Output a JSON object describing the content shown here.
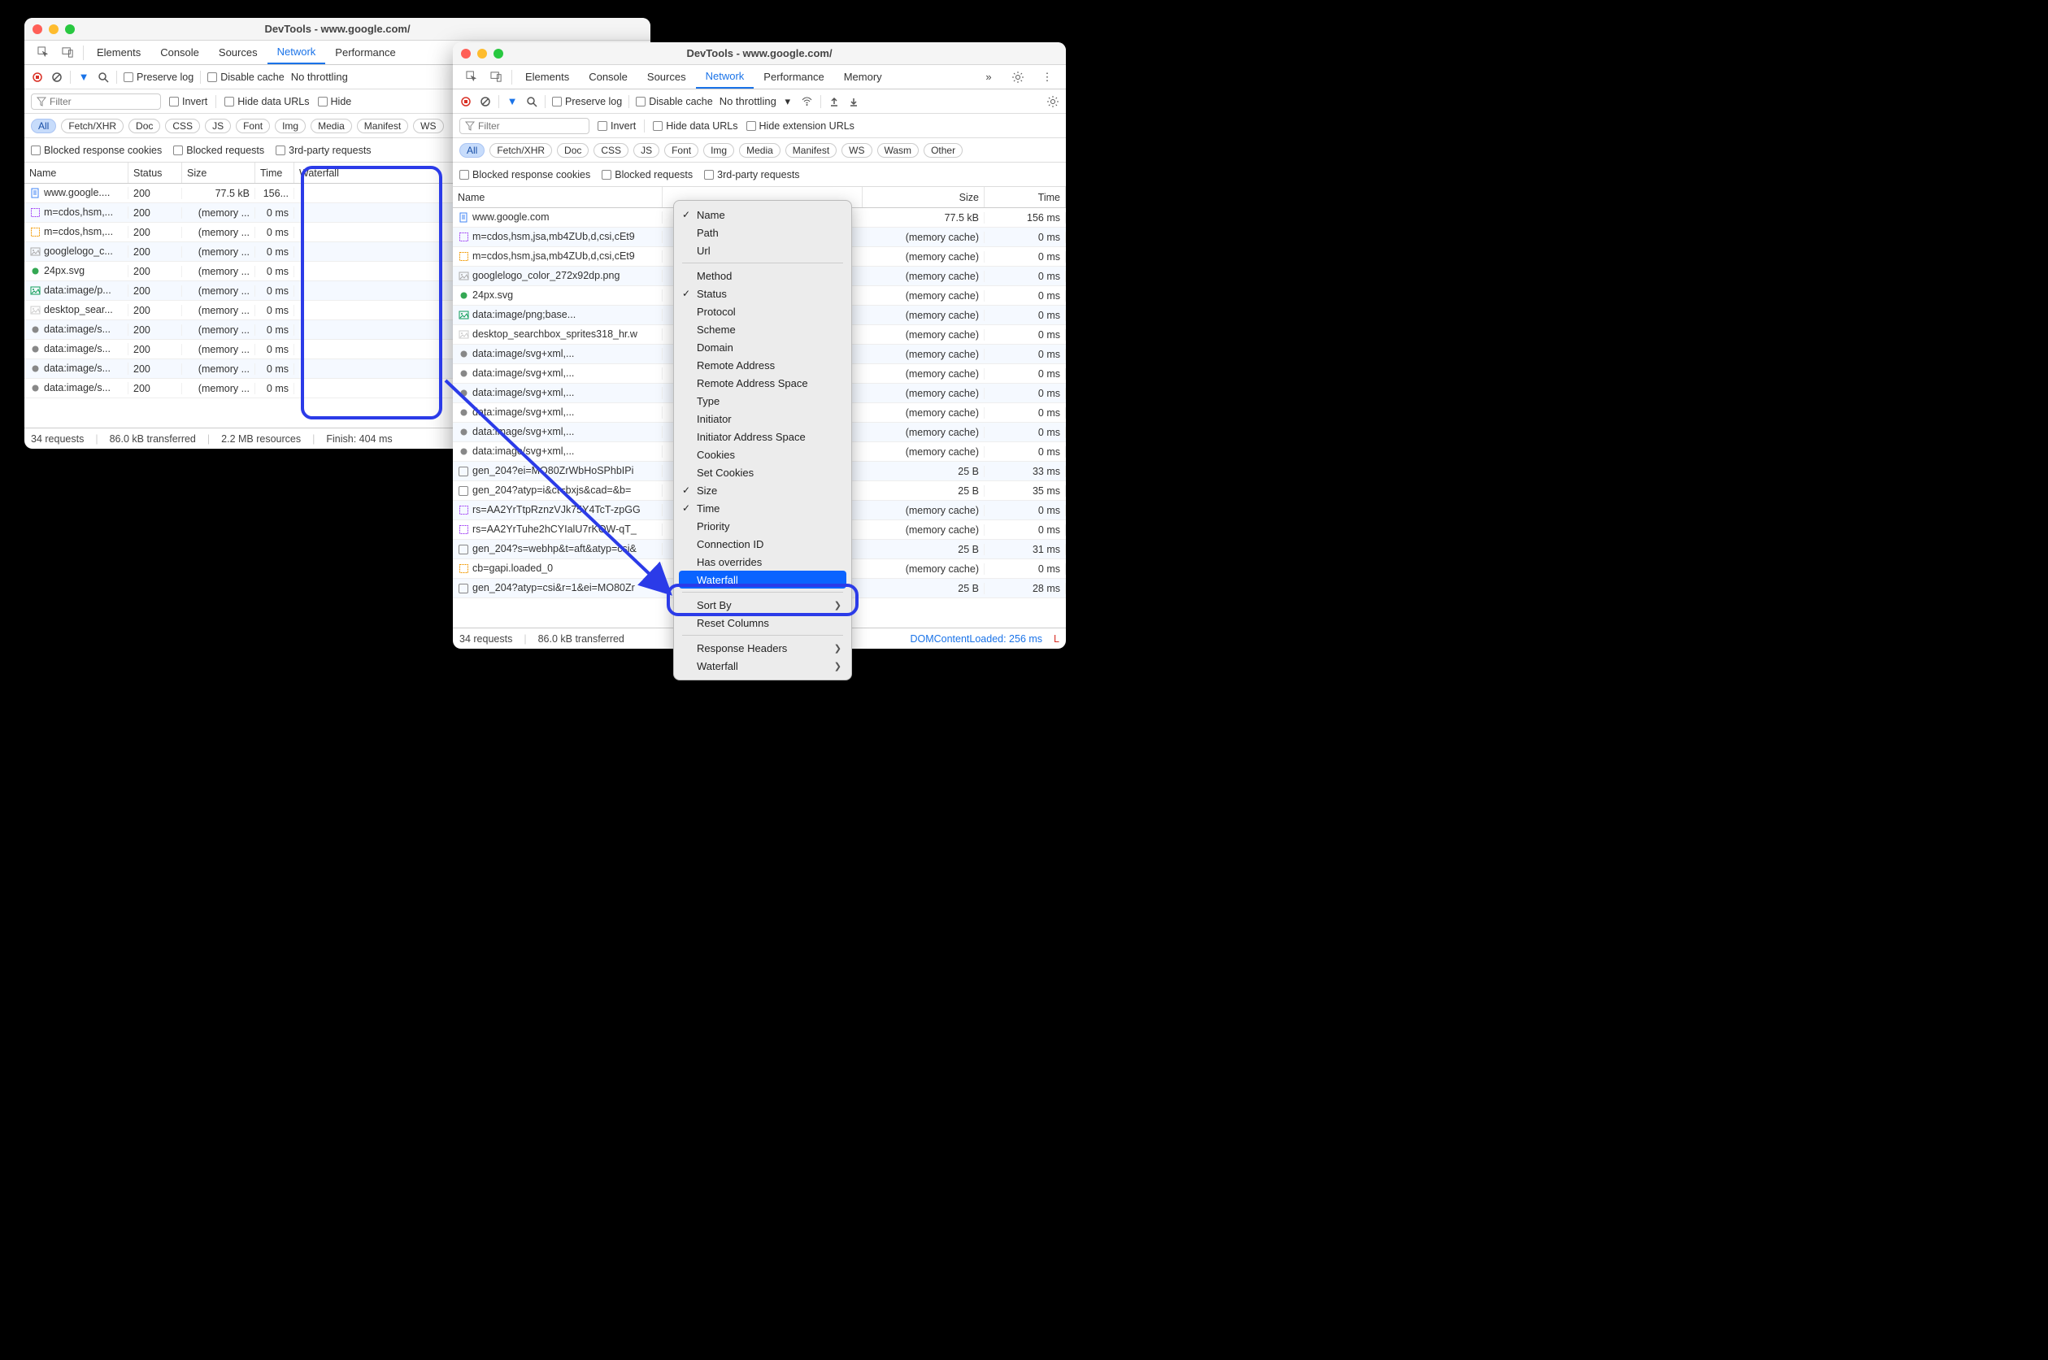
{
  "window1": {
    "title": "DevTools - www.google.com/",
    "tabs": [
      "Elements",
      "Console",
      "Sources",
      "Network",
      "Performance"
    ],
    "activeTab": "Network",
    "toolbar": {
      "preserve": "Preserve log",
      "disablecache": "Disable cache",
      "throttling": "No throttling"
    },
    "filter": {
      "placeholder": "Filter",
      "invert": "Invert",
      "hidedata": "Hide data URLs",
      "hideext": "Hide"
    },
    "types": [
      "All",
      "Fetch/XHR",
      "Doc",
      "CSS",
      "JS",
      "Font",
      "Img",
      "Media",
      "Manifest",
      "WS"
    ],
    "activeType": "All",
    "chk2": {
      "blockedcookies": "Blocked response cookies",
      "blockedreq": "Blocked requests",
      "thirdparty": "3rd-party requests"
    },
    "headers": [
      "Name",
      "Status",
      "Size",
      "Time",
      "Waterfall"
    ],
    "rows": [
      {
        "name": "www.google....",
        "status": "200",
        "size": "77.5 kB",
        "time": "156...",
        "wfstart": 0,
        "wflen": 85,
        "wfblue": 88,
        "icon": "doc",
        "iconcolor": "#4285f4"
      },
      {
        "name": "m=cdos,hsm,...",
        "status": "200",
        "size": "(memory ...",
        "time": "0 ms",
        "wfblue": 92,
        "icon": "js",
        "iconcolor": "#a142f4"
      },
      {
        "name": "m=cdos,hsm,...",
        "status": "200",
        "size": "(memory ...",
        "time": "0 ms",
        "wfblue": 92,
        "icon": "js",
        "iconcolor": "#f29900"
      },
      {
        "name": "googlelogo_c...",
        "status": "200",
        "size": "(memory ...",
        "time": "0 ms",
        "wfblue": 92,
        "icon": "img",
        "iconcolor": "#aaa"
      },
      {
        "name": "24px.svg",
        "status": "200",
        "size": "(memory ...",
        "time": "0 ms",
        "wfblue": 93,
        "icon": "svg",
        "iconcolor": "#34a853"
      },
      {
        "name": "data:image/p...",
        "status": "200",
        "size": "(memory ...",
        "time": "0 ms",
        "wfblue": 93,
        "icon": "img",
        "iconcolor": "#0f9d58"
      },
      {
        "name": "desktop_sear...",
        "status": "200",
        "size": "(memory ...",
        "time": "0 ms",
        "wfblue": 93,
        "icon": "img",
        "iconcolor": "#ccc"
      },
      {
        "name": "data:image/s...",
        "status": "200",
        "size": "(memory ...",
        "time": "0 ms",
        "wfblue": 94,
        "icon": "svg",
        "iconcolor": "#888"
      },
      {
        "name": "data:image/s...",
        "status": "200",
        "size": "(memory ...",
        "time": "0 ms",
        "wfblue": 94,
        "icon": "svg",
        "iconcolor": "#888"
      },
      {
        "name": "data:image/s...",
        "status": "200",
        "size": "(memory ...",
        "time": "0 ms",
        "wfblue": 94,
        "icon": "svg",
        "iconcolor": "#888"
      },
      {
        "name": "data:image/s...",
        "status": "200",
        "size": "(memory ...",
        "time": "0 ms",
        "wfblue": 94,
        "icon": "svg",
        "iconcolor": "#888"
      }
    ],
    "status": {
      "requests": "34 requests",
      "transferred": "86.0 kB transferred",
      "resources": "2.2 MB resources",
      "finish": "Finish: 404 ms"
    }
  },
  "window2": {
    "title": "DevTools - www.google.com/",
    "tabs": [
      "Elements",
      "Console",
      "Sources",
      "Network",
      "Performance",
      "Memory"
    ],
    "activeTab": "Network",
    "toolbar": {
      "preserve": "Preserve log",
      "disablecache": "Disable cache",
      "throttling": "No throttling"
    },
    "filter": {
      "placeholder": "Filter",
      "invert": "Invert",
      "hidedata": "Hide data URLs",
      "hideext": "Hide extension URLs"
    },
    "types": [
      "All",
      "Fetch/XHR",
      "Doc",
      "CSS",
      "JS",
      "Font",
      "Img",
      "Media",
      "Manifest",
      "WS",
      "Wasm",
      "Other"
    ],
    "activeType": "All",
    "chk2": {
      "blockedcookies": "Blocked response cookies",
      "blockedreq": "Blocked requests",
      "thirdparty": "3rd-party requests"
    },
    "headers": [
      "Name",
      "",
      "Size",
      "Time"
    ],
    "rows": [
      {
        "name": "www.google.com",
        "size": "77.5 kB",
        "time": "156 ms",
        "icon": "doc",
        "iconcolor": "#4285f4"
      },
      {
        "name": "m=cdos,hsm,jsa,mb4ZUb,d,csi,cEt9",
        "size": "(memory cache)",
        "time": "0 ms",
        "icon": "js",
        "iconcolor": "#a142f4"
      },
      {
        "name": "m=cdos,hsm,jsa,mb4ZUb,d,csi,cEt9",
        "size": "(memory cache)",
        "time": "0 ms",
        "icon": "js",
        "iconcolor": "#f29900"
      },
      {
        "name": "googlelogo_color_272x92dp.png",
        "size": "(memory cache)",
        "time": "0 ms",
        "icon": "img",
        "iconcolor": "#aaa"
      },
      {
        "name": "24px.svg",
        "size": "(memory cache)",
        "time": "0 ms",
        "icon": "svg",
        "iconcolor": "#34a853"
      },
      {
        "name": "data:image/png;base...",
        "size": "(memory cache)",
        "time": "0 ms",
        "icon": "img",
        "iconcolor": "#0f9d58"
      },
      {
        "name": "desktop_searchbox_sprites318_hr.w",
        "size": "(memory cache)",
        "time": "0 ms",
        "icon": "img",
        "iconcolor": "#ccc"
      },
      {
        "name": "data:image/svg+xml,...",
        "size": "(memory cache)",
        "time": "0 ms",
        "icon": "svg",
        "iconcolor": "#888"
      },
      {
        "name": "data:image/svg+xml,...",
        "size": "(memory cache)",
        "time": "0 ms",
        "icon": "svg",
        "iconcolor": "#888"
      },
      {
        "name": "data:image/svg+xml,...",
        "size": "(memory cache)",
        "time": "0 ms",
        "icon": "svg",
        "iconcolor": "#888"
      },
      {
        "name": "data:image/svg+xml,...",
        "size": "(memory cache)",
        "time": "0 ms",
        "icon": "svg",
        "iconcolor": "#888"
      },
      {
        "name": "data:image/svg+xml,...",
        "size": "(memory cache)",
        "time": "0 ms",
        "icon": "svg",
        "iconcolor": "#888"
      },
      {
        "name": "data:image/svg+xml,...",
        "size": "(memory cache)",
        "time": "0 ms",
        "icon": "svg",
        "iconcolor": "#888"
      },
      {
        "name": "gen_204?ei=MO80ZrWbHoSPhbIPi",
        "size": "25 B",
        "time": "33 ms",
        "chk": true
      },
      {
        "name": "gen_204?atyp=i&ct=bxjs&cad=&b=",
        "size": "25 B",
        "time": "35 ms",
        "chk": true,
        "icon": "img",
        "iconcolor": "#ddd"
      },
      {
        "name": "rs=AA2YrTtpRznzVJk75Y4TcT-zpGG",
        "size": "(memory cache)",
        "time": "0 ms",
        "icon": "js",
        "iconcolor": "#a142f4"
      },
      {
        "name": "rs=AA2YrTuhe2hCYIalU7rKOW-qT_",
        "size": "(memory cache)",
        "time": "0 ms",
        "icon": "js",
        "iconcolor": "#a142f4"
      },
      {
        "name": "gen_204?s=webhp&t=aft&atyp=csi&",
        "size": "25 B",
        "time": "31 ms",
        "chk": true
      },
      {
        "name": "cb=gapi.loaded_0",
        "size": "(memory cache)",
        "time": "0 ms",
        "icon": "js",
        "iconcolor": "#f29900"
      },
      {
        "name": "gen_204?atyp=csi&r=1&ei=MO80Zr",
        "size": "25 B",
        "time": "28 ms",
        "chk": true
      }
    ],
    "status": {
      "requests": "34 requests",
      "transferred": "86.0 kB transferred",
      "dcl": "DOMContentLoaded: 256 ms",
      "l": "L"
    }
  },
  "contextMenu": {
    "items": [
      {
        "label": "Name",
        "checked": true
      },
      {
        "label": "Path"
      },
      {
        "label": "Url"
      },
      {
        "divider": true
      },
      {
        "label": "Method"
      },
      {
        "label": "Status",
        "checked": true
      },
      {
        "label": "Protocol"
      },
      {
        "label": "Scheme"
      },
      {
        "label": "Domain"
      },
      {
        "label": "Remote Address"
      },
      {
        "label": "Remote Address Space"
      },
      {
        "label": "Type"
      },
      {
        "label": "Initiator"
      },
      {
        "label": "Initiator Address Space"
      },
      {
        "label": "Cookies"
      },
      {
        "label": "Set Cookies"
      },
      {
        "label": "Size",
        "checked": true
      },
      {
        "label": "Time",
        "checked": true
      },
      {
        "label": "Priority"
      },
      {
        "label": "Connection ID"
      },
      {
        "label": "Has overrides"
      },
      {
        "label": "Waterfall",
        "highlight": true
      },
      {
        "divider": true
      },
      {
        "label": "Sort By",
        "submenu": true
      },
      {
        "label": "Reset Columns"
      },
      {
        "divider": true
      },
      {
        "label": "Response Headers",
        "submenu": true
      },
      {
        "label": "Waterfall",
        "submenu": true
      }
    ]
  }
}
